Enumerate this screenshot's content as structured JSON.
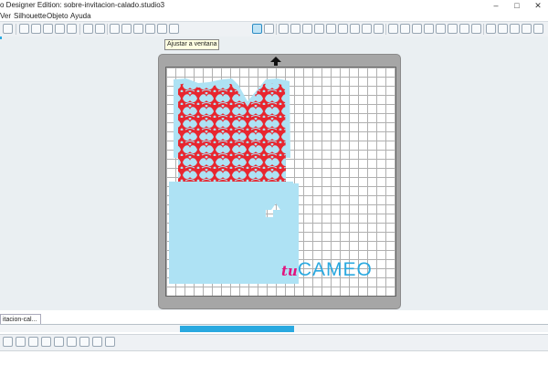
{
  "window": {
    "title": "o Designer Edition: sobre-invitacion-calado.studio3"
  },
  "menu": {
    "items": [
      "Ver",
      "Silhouette",
      "Objeto",
      "Ayuda"
    ]
  },
  "tooltip": {
    "text": "Ajustar a ventana"
  },
  "document_tab": {
    "label": "itacion-cal..."
  },
  "logo": {
    "tu": "tu",
    "cameo": "CAMEO"
  },
  "colors": {
    "accent": "#2aa9e0",
    "envelope": "#aee2f4",
    "lace": "#e8262f",
    "logo_tu": "#e2127c"
  },
  "toolbar": {
    "left_tools": [
      "new-icon",
      "open-icon",
      "save-icon",
      "print-icon",
      "cut-icon",
      "copy-icon",
      "paste-icon",
      "undo-icon",
      "redo-icon",
      "pan-icon",
      "zoom-in-icon",
      "zoom-out-icon",
      "zoom-box-icon",
      "drag-zoom-icon",
      "fit-to-window-icon"
    ],
    "right_tools": [
      "select-icon",
      "edit-points-icon",
      "line-icon",
      "rectangle-icon",
      "rounded-rect-icon",
      "ellipse-icon",
      "polygon-icon",
      "curve-icon",
      "arc-icon",
      "polyline-icon",
      "freehand-icon",
      "smooth-freehand-icon",
      "text-icon",
      "eraser-icon",
      "knife-icon",
      "page-icon",
      "fill-color-icon",
      "line-color-icon",
      "line-style-icon",
      "layers-icon",
      "cut-settings-icon",
      "send-icon",
      "settings-icon"
    ]
  },
  "bottom_toolbar": {
    "tools": [
      "group-icon",
      "ungroup-icon",
      "release-compound-icon",
      "make-compound-icon",
      "weld-icon",
      "offset-icon",
      "trace-icon",
      "replicate-icon",
      "modify-icon"
    ]
  }
}
